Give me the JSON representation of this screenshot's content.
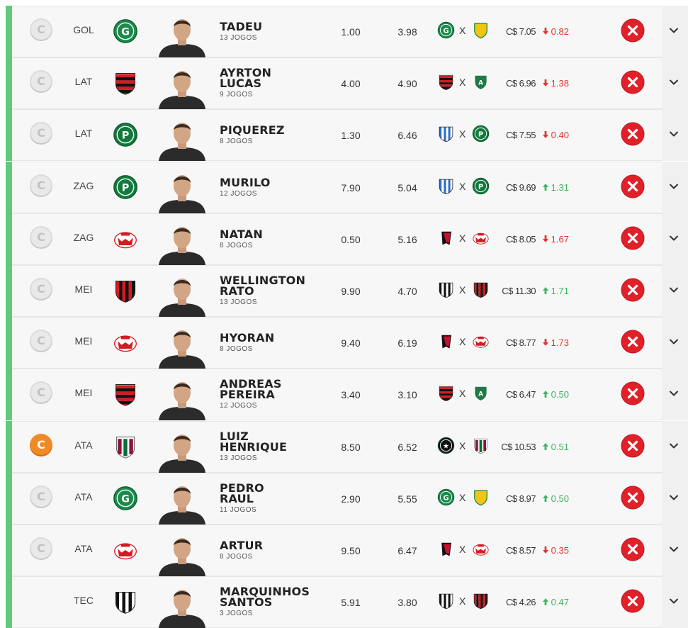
{
  "colors": {
    "accent_bar": "#5ecb7b",
    "remove": "#e2202a",
    "down": "#e2362f",
    "up": "#3fb463",
    "captain_active": "#f08a24"
  },
  "labels": {
    "captain": "C",
    "versus": "X",
    "currency": "C$"
  },
  "players": [
    {
      "captain": "inactive",
      "position": "GOL",
      "club": "goias",
      "name1": "TADEU",
      "name2": "",
      "games": "13 JOGOS",
      "stat1": "1.00",
      "stat2": "3.98",
      "home": "goias",
      "away": "cuiaba",
      "price": "C$ 7.05",
      "variation": "0.82",
      "trend": "down"
    },
    {
      "captain": "inactive",
      "position": "LAT",
      "club": "flamengo",
      "name1": "AYRTON",
      "name2": "LUCAS",
      "games": "9 JOGOS",
      "stat1": "4.00",
      "stat2": "4.90",
      "home": "flamengo",
      "away": "america-mg",
      "price": "C$ 6.96",
      "variation": "1.38",
      "trend": "down"
    },
    {
      "captain": "inactive",
      "position": "LAT",
      "club": "palmeiras",
      "name1": "PIQUEREZ",
      "name2": "",
      "games": "8 JOGOS",
      "stat1": "1.30",
      "stat2": "6.46",
      "home": "avai",
      "away": "palmeiras",
      "price": "C$ 7.55",
      "variation": "0.40",
      "trend": "down"
    },
    {
      "captain": "inactive",
      "position": "ZAG",
      "club": "palmeiras",
      "name1": "MURILO",
      "name2": "",
      "games": "12 JOGOS",
      "stat1": "7.90",
      "stat2": "5.04",
      "home": "avai",
      "away": "palmeiras",
      "price": "C$ 9.69",
      "variation": "1.31",
      "trend": "up"
    },
    {
      "captain": "inactive",
      "position": "ZAG",
      "club": "bragantino",
      "name1": "NATAN",
      "name2": "",
      "games": "8 JOGOS",
      "stat1": "0.50",
      "stat2": "5.16",
      "home": "athletico-pr",
      "away": "bragantino",
      "price": "C$ 8.05",
      "variation": "1.67",
      "trend": "down"
    },
    {
      "captain": "inactive",
      "position": "MEI",
      "club": "atletico-go",
      "name1": "WELLINGTON",
      "name2": "RATO",
      "games": "13 JOGOS",
      "stat1": "9.90",
      "stat2": "4.70",
      "home": "ceara",
      "away": "atletico-go",
      "price": "C$ 11.30",
      "variation": "1.71",
      "trend": "up"
    },
    {
      "captain": "inactive",
      "position": "MEI",
      "club": "bragantino",
      "name1": "HYORAN",
      "name2": "",
      "games": "8 JOGOS",
      "stat1": "9.40",
      "stat2": "6.19",
      "home": "athletico-pr",
      "away": "bragantino",
      "price": "C$ 8.77",
      "variation": "1.73",
      "trend": "down"
    },
    {
      "captain": "inactive",
      "position": "MEI",
      "club": "flamengo",
      "name1": "ANDREAS",
      "name2": "PEREIRA",
      "games": "12 JOGOS",
      "stat1": "3.40",
      "stat2": "3.10",
      "home": "flamengo",
      "away": "america-mg",
      "price": "C$ 6.47",
      "variation": "0.50",
      "trend": "up"
    },
    {
      "captain": "active",
      "position": "ATA",
      "club": "fluminense",
      "name1": "LUIZ",
      "name2": "HENRIQUE",
      "games": "13 JOGOS",
      "stat1": "8.50",
      "stat2": "6.52",
      "home": "botafogo",
      "away": "fluminense",
      "price": "C$ 10.53",
      "variation": "0.51",
      "trend": "up"
    },
    {
      "captain": "inactive",
      "position": "ATA",
      "club": "goias",
      "name1": "PEDRO",
      "name2": "RAUL",
      "games": "11 JOGOS",
      "stat1": "2.90",
      "stat2": "5.55",
      "home": "goias",
      "away": "cuiaba",
      "price": "C$ 8.97",
      "variation": "0.50",
      "trend": "up"
    },
    {
      "captain": "inactive",
      "position": "ATA",
      "club": "bragantino",
      "name1": "ARTUR",
      "name2": "",
      "games": "8 JOGOS",
      "stat1": "9.50",
      "stat2": "6.47",
      "home": "athletico-pr",
      "away": "bragantino",
      "price": "C$ 8.57",
      "variation": "0.35",
      "trend": "down"
    },
    {
      "captain": "none",
      "position": "TEC",
      "club": "ceara",
      "name1": "MARQUINHOS",
      "name2": "SANTOS",
      "games": "3 JOGOS",
      "stat1": "5.91",
      "stat2": "3.80",
      "home": "ceara",
      "away": "atletico-go",
      "price": "C$ 4.26",
      "variation": "0.47",
      "trend": "up"
    }
  ]
}
